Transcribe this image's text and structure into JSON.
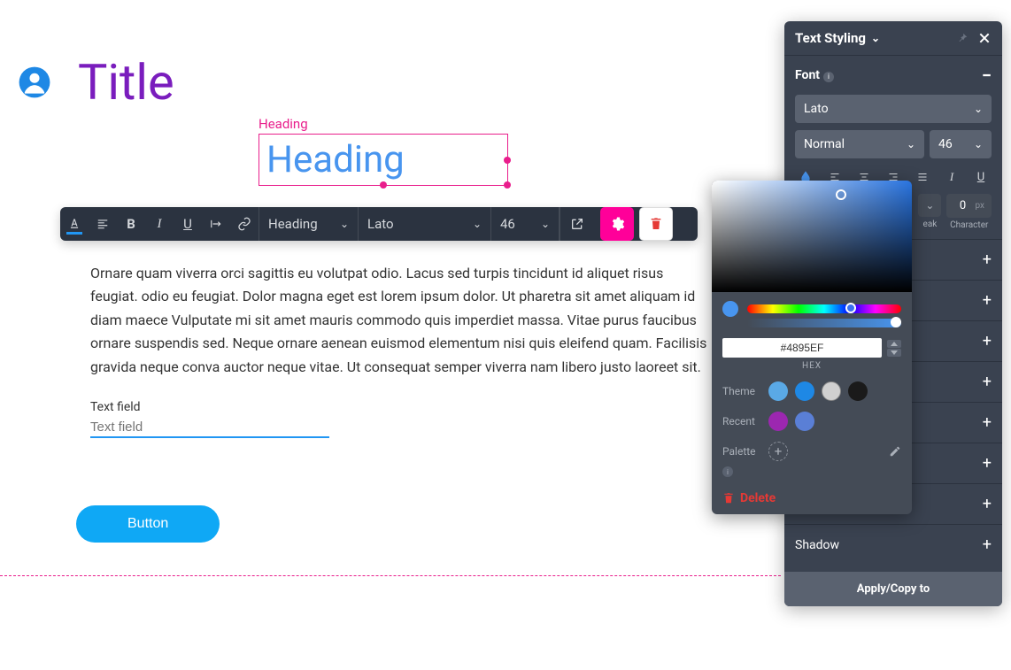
{
  "canvas": {
    "title": "Title",
    "heading_label": "Heading",
    "heading_text": "Heading",
    "body": "Ornare quam viverra orci sagittis eu volutpat odio. Lacus sed turpis tincidunt id aliquet risus feugiat. odio eu feugiat. Dolor magna eget est lorem ipsum dolor. Ut pharetra sit amet aliquam id diam maece Vulputate mi sit amet mauris commodo quis imperdiet massa. Vitae purus faucibus ornare suspendis sed. Neque ornare aenean euismod elementum nisi quis eleifend quam. Facilisis gravida neque conva auctor neque vitae. Ut consequat semper viverra nam libero justo laoreet sit.",
    "tf_label": "Text field",
    "tf_placeholder": "Text field",
    "button": "Button"
  },
  "toolbar": {
    "style": "Heading",
    "font": "Lato",
    "size": "46"
  },
  "panel": {
    "title": "Text Styling",
    "font_section": "Font",
    "font_value": "Lato",
    "weight_value": "Normal",
    "size_value": "46",
    "break_label": "eak",
    "char_label": "Character",
    "char_value": "0",
    "char_unit": "px",
    "shadow": "Shadow",
    "apply": "Apply/Copy to"
  },
  "colorpicker": {
    "hex": "#4895EF",
    "hex_label": "HEX",
    "theme_label": "Theme",
    "recent_label": "Recent",
    "palette_label": "Palette",
    "delete": "Delete"
  }
}
